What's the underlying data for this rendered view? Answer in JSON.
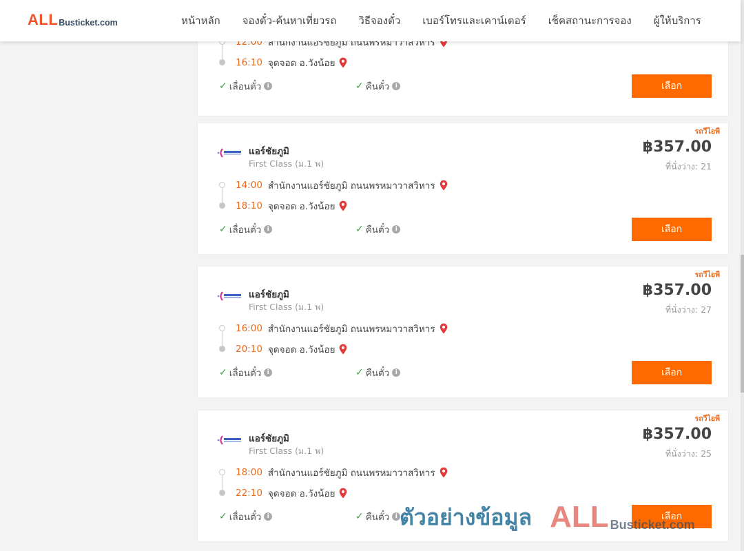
{
  "header": {
    "logo_all": "ALL",
    "logo_busticket": "Busticket.com",
    "nav": [
      "หน้าหลัก",
      "จองตั๋ว-ค้นหาเที่ยวรถ",
      "วิธีจองตั๋ว",
      "เบอร์โทรและเคาน์เตอร์",
      "เช็คสถานะการจอง",
      "ผู้ให้บริการ"
    ]
  },
  "colors": {
    "brand_orange": "#ff6a00",
    "time_orange": "#ee6a1a",
    "check_green": "#3aa14a",
    "pin_red": "#e23b3b"
  },
  "features": {
    "reschedule": "เลื่อนตั๋ว",
    "refund": "คืนตั๋ว"
  },
  "select_label": "เลือก",
  "partial_card": {
    "depart_time": "12:00",
    "depart_place": "สำนักงานแอร์ชัยภูมิ ถนนพรหมาวาสวิหาร",
    "arrive_time": "16:10",
    "arrive_place": "จุดจอด อ.วังน้อย"
  },
  "trips": [
    {
      "tag": "รถวีไอพี",
      "operator": "แอร์ชัยภูมิ",
      "class": "First Class (ม.1 พ)",
      "price": "฿357.00",
      "seats": "ที่นั่งว่าง: 21",
      "depart_time": "14:00",
      "depart_place": "สำนักงานแอร์ชัยภูมิ ถนนพรหมาวาสวิหาร",
      "arrive_time": "18:10",
      "arrive_place": "จุดจอด อ.วังน้อย"
    },
    {
      "tag": "รถวีไอพี",
      "operator": "แอร์ชัยภูมิ",
      "class": "First Class (ม.1 พ)",
      "price": "฿357.00",
      "seats": "ที่นั่งว่าง: 27",
      "depart_time": "16:00",
      "depart_place": "สำนักงานแอร์ชัยภูมิ ถนนพรหมาวาสวิหาร",
      "arrive_time": "20:10",
      "arrive_place": "จุดจอด อ.วังน้อย"
    },
    {
      "tag": "รถวีไอพี",
      "operator": "แอร์ชัยภูมิ",
      "class": "First Class (ม.1 พ)",
      "price": "฿357.00",
      "seats": "ที่นั่งว่าง: 25",
      "depart_time": "18:00",
      "depart_place": "สำนักงานแอร์ชัยภูมิ ถนนพรหมาวาสวิหาร",
      "arrive_time": "22:10",
      "arrive_place": "จุดจอด อ.วังน้อย"
    }
  ],
  "watermark": {
    "text": "ตัวอย่างข้อมูล",
    "all": "ALL",
    "busticket": "Busticket.com"
  }
}
